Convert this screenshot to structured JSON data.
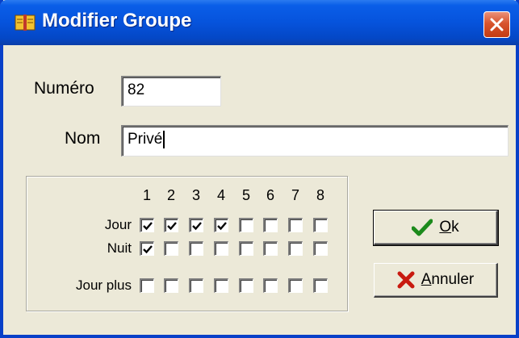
{
  "window": {
    "title": "Modifier Groupe",
    "close_icon": "close-icon",
    "app_icon": "book-icon"
  },
  "form": {
    "numero_label": "Numéro",
    "numero_value": "82",
    "nom_label": "Nom",
    "nom_value": "Privé"
  },
  "schedule": {
    "columns": [
      "1",
      "2",
      "3",
      "4",
      "5",
      "6",
      "7",
      "8"
    ],
    "rows": [
      {
        "label": "Jour",
        "checked": [
          true,
          true,
          true,
          true,
          false,
          false,
          false,
          false
        ]
      },
      {
        "label": "Nuit",
        "checked": [
          true,
          false,
          false,
          false,
          false,
          false,
          false,
          false
        ]
      },
      {
        "label": "Jour plus",
        "checked": [
          false,
          false,
          false,
          false,
          false,
          false,
          false,
          false
        ]
      }
    ]
  },
  "buttons": {
    "ok": {
      "mnemonic": "O",
      "rest": "k",
      "icon": "checkmark-icon",
      "icon_color": "#1c8a1c"
    },
    "annuler": {
      "mnemonic": "A",
      "rest": "nnuler",
      "icon": "x-icon",
      "icon_color": "#c81a10"
    }
  }
}
